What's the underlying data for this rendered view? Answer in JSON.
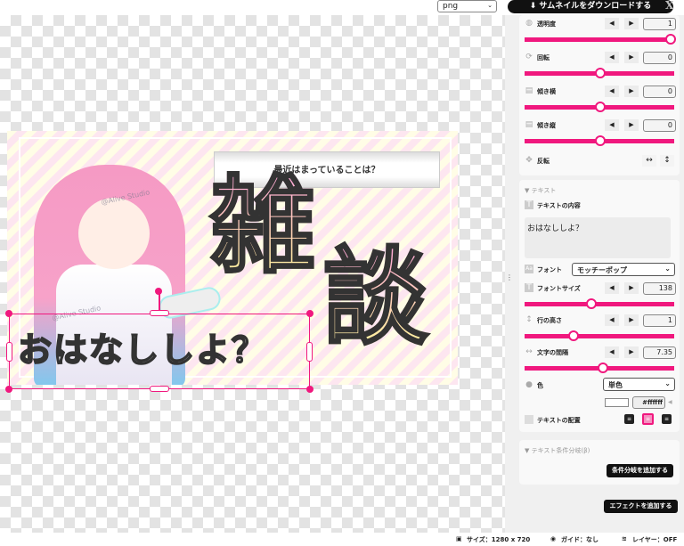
{
  "topbar": {
    "format": "png",
    "download_label": "サムネイルをダウンロードする",
    "x_logo": "X"
  },
  "canvas": {
    "title_text": "最近はまっていることは？",
    "big_text_1": "雑",
    "big_text_2": "談",
    "selected_text": "おはなししよ？",
    "watermark": "@Alive Studio"
  },
  "panel": {
    "opacity": {
      "label": "透明度",
      "value": "1",
      "slider": 1.0
    },
    "rotation": {
      "label": "回転",
      "value": "0",
      "slider": 0.5
    },
    "skew_x": {
      "label": "傾き横",
      "value": "0",
      "slider": 0.5
    },
    "skew_y": {
      "label": "傾き縦",
      "value": "0",
      "slider": 0.5
    },
    "flip": {
      "label": "反転",
      "h": "↔",
      "v": "↕"
    },
    "text_section": "▼ テキスト",
    "content_label": "テキストの内容",
    "content_value": "おはなししよ？",
    "font_label": "フォント",
    "font_value": "モッチーポップ",
    "font_size": {
      "label": "フォントサイズ",
      "value": "138",
      "slider": 0.42
    },
    "line_height": {
      "label": "行の高さ",
      "value": "1",
      "slider": 0.3
    },
    "letter_spacing": {
      "label": "文字の間隔",
      "value": "7.35",
      "slider": 0.51
    },
    "color_label": "色",
    "color_mode": "単色",
    "color_hex": "#ffffff",
    "color_value": "#ffffff",
    "align_label": "テキストの配置",
    "align_selected": "center",
    "cond_section": "▼ テキスト条件分岐(β)",
    "add_condition": "条件分岐を追加する",
    "add_effect": "エフェクトを追加する",
    "accent": "#f0187e"
  },
  "status": {
    "size": "サイズ：1280 x 720",
    "guide": "ガイド：なし",
    "layer": "レイヤー：OFF"
  }
}
